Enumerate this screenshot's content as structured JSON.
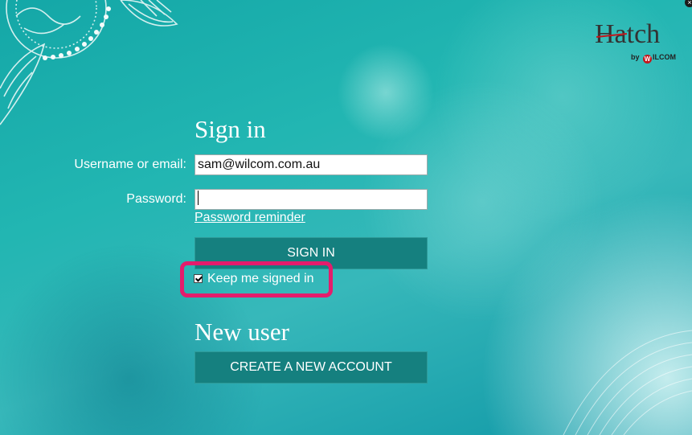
{
  "brand": {
    "logo_text": "Hatch",
    "logo_sub_prefix": "by",
    "logo_sub_mark": "W",
    "logo_sub_name": "ILCOM",
    "accent": "#c4161c"
  },
  "close_icon": "×",
  "sign_in": {
    "heading": "Sign in",
    "username_label": "Username or email:",
    "username_value": "sam@wilcom.com.au",
    "password_label": "Password:",
    "password_value": "",
    "reminder_link": "Password reminder",
    "sign_in_button": "SIGN IN",
    "keep_signed_in_label": "Keep me signed in",
    "keep_signed_in_checked": true
  },
  "new_user": {
    "heading": "New user",
    "create_button": "CREATE A NEW ACCOUNT"
  },
  "colors": {
    "button_bg": "#15807f",
    "highlight": "#e41c6c"
  }
}
